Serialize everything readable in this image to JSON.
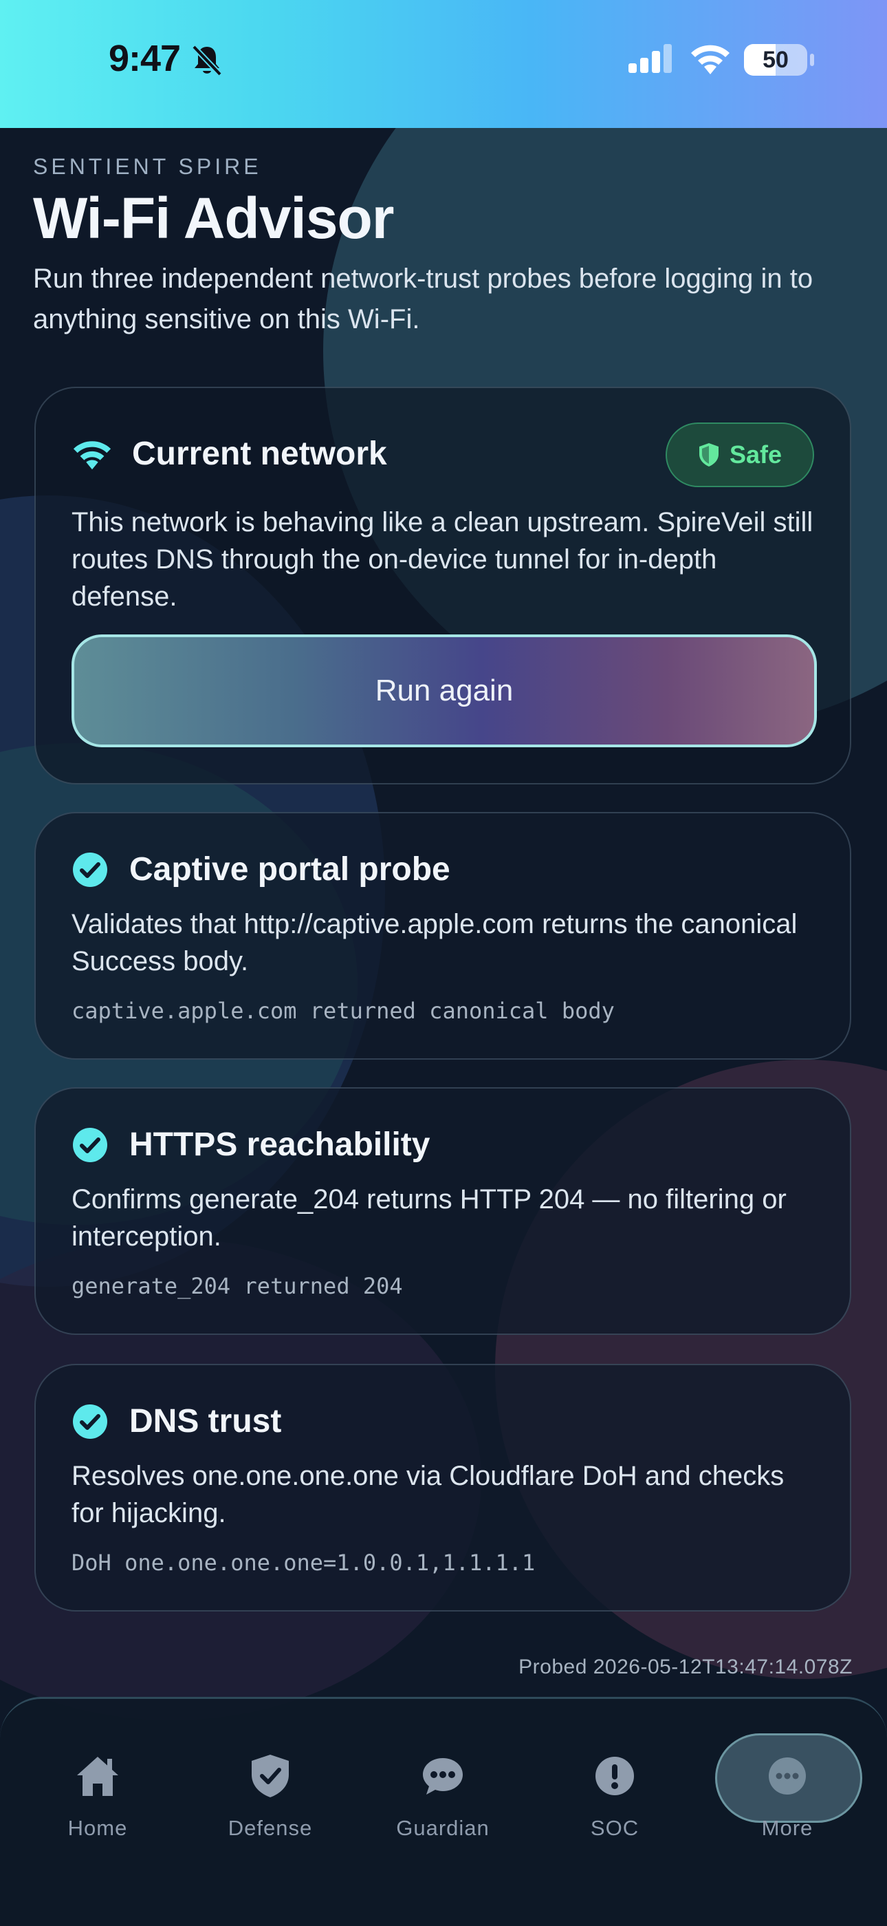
{
  "status_bar": {
    "time": "9:47",
    "battery": "50"
  },
  "header": {
    "kicker": "SENTIENT SPIRE",
    "title": "Wi-Fi Advisor",
    "subtitle": "Run three independent network-trust probes before logging in to anything sensitive on this Wi-Fi."
  },
  "current_network": {
    "label": "Current network",
    "badge": "Safe",
    "description": "This network is behaving like a clean upstream. SpireVeil still routes DNS through the on-device tunnel for in-depth defense.",
    "run_button": "Run again"
  },
  "probes": [
    {
      "title": "Captive portal probe",
      "description": "Validates that http://captive.apple.com returns the canonical Success body.",
      "result": "captive.apple.com returned canonical body"
    },
    {
      "title": "HTTPS reachability",
      "description": "Confirms generate_204 returns HTTP 204 — no filtering or interception.",
      "result": "generate_204 returned 204"
    },
    {
      "title": "DNS trust",
      "description": "Resolves one.one.one.one via Cloudflare DoH and checks for hijacking.",
      "result": "DoH one.one.one.one=1.0.0.1,1.1.1.1"
    }
  ],
  "probed_at": "Probed 2026-05-12T13:47:14.078Z",
  "tabs": [
    {
      "label": "Home",
      "icon": "home-icon"
    },
    {
      "label": "Defense",
      "icon": "shield-check-icon"
    },
    {
      "label": "Guardian",
      "icon": "chat-bubble-icon"
    },
    {
      "label": "SOC",
      "icon": "alert-icon"
    },
    {
      "label": "More",
      "icon": "more-icon"
    }
  ],
  "colors": {
    "accent": "#5ee9ec",
    "safe": "#63e89d",
    "background": "#0e1828"
  }
}
